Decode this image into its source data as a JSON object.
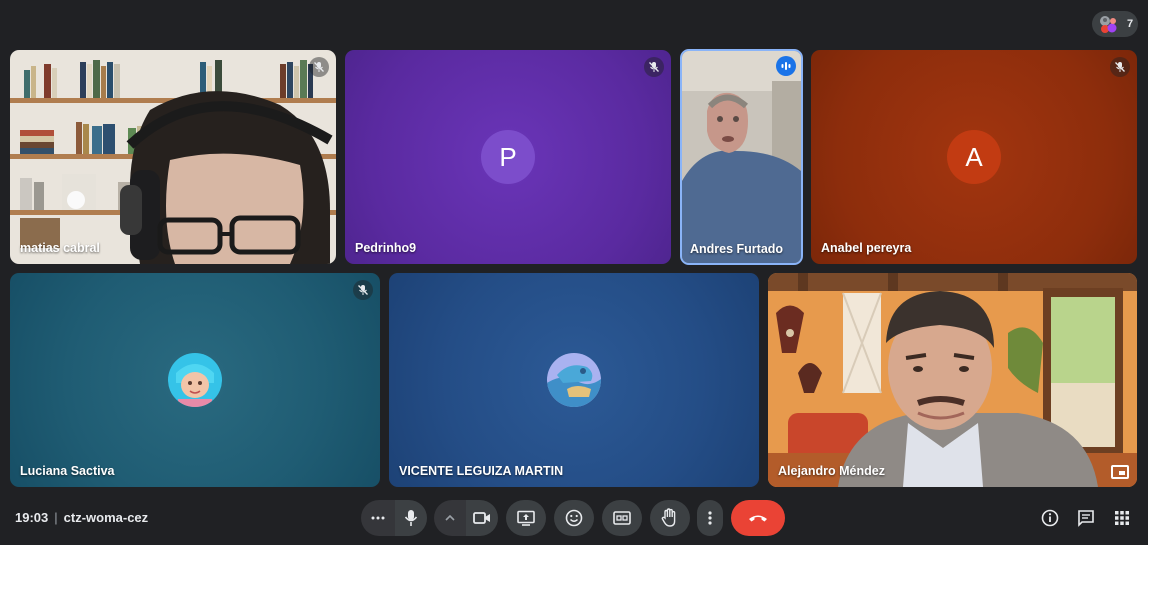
{
  "meeting": {
    "time": "19:03",
    "separator": "|",
    "code": "ctz-woma-cez",
    "participant_count": "7"
  },
  "tiles": [
    {
      "name": "matias cabral",
      "muted": true,
      "type": "video"
    },
    {
      "name": "Pedrinho9",
      "muted": true,
      "type": "initial",
      "initial": "P",
      "bg": "#5e2ca5",
      "avatar_color": "#7c4dcb"
    },
    {
      "name": "Andres Furtado",
      "muted": false,
      "speaking": true,
      "type": "video"
    },
    {
      "name": "Anabel pereyra",
      "muted": true,
      "type": "initial",
      "initial": "A",
      "bg": "#8f2c0e",
      "avatar_color": "#c23b12"
    },
    {
      "name": "Luciana Sactiva",
      "muted": true,
      "type": "avatar",
      "bg": "#1f5c73"
    },
    {
      "name": "VICENTE LEGUIZA MARTIN",
      "muted": false,
      "type": "avatar",
      "bg": "#244d86"
    },
    {
      "name": "Alejandro Méndez",
      "muted": false,
      "type": "video"
    }
  ],
  "controls": [
    {
      "id": "more-options-mic",
      "icon": "three-dots-icon"
    },
    {
      "id": "microphone",
      "icon": "microphone-icon"
    },
    {
      "id": "camera-options",
      "icon": "chevron-up-icon"
    },
    {
      "id": "camera",
      "icon": "video-camera-icon"
    },
    {
      "id": "present",
      "icon": "present-screen-icon"
    },
    {
      "id": "reactions",
      "icon": "emoji-icon"
    },
    {
      "id": "captions",
      "icon": "captions-icon"
    },
    {
      "id": "raise-hand",
      "icon": "hand-icon"
    },
    {
      "id": "more-options",
      "icon": "more-vert-icon"
    },
    {
      "id": "leave-call",
      "icon": "phone-hangup-icon"
    }
  ],
  "right_controls": [
    {
      "id": "meeting-details",
      "icon": "info-icon"
    },
    {
      "id": "chat",
      "icon": "chat-icon"
    },
    {
      "id": "activities",
      "icon": "grid-icon"
    }
  ],
  "colors": {
    "background": "#202124",
    "control": "#3c4043",
    "end_call": "#ea4335",
    "speaking_border": "#8ab4f8"
  }
}
